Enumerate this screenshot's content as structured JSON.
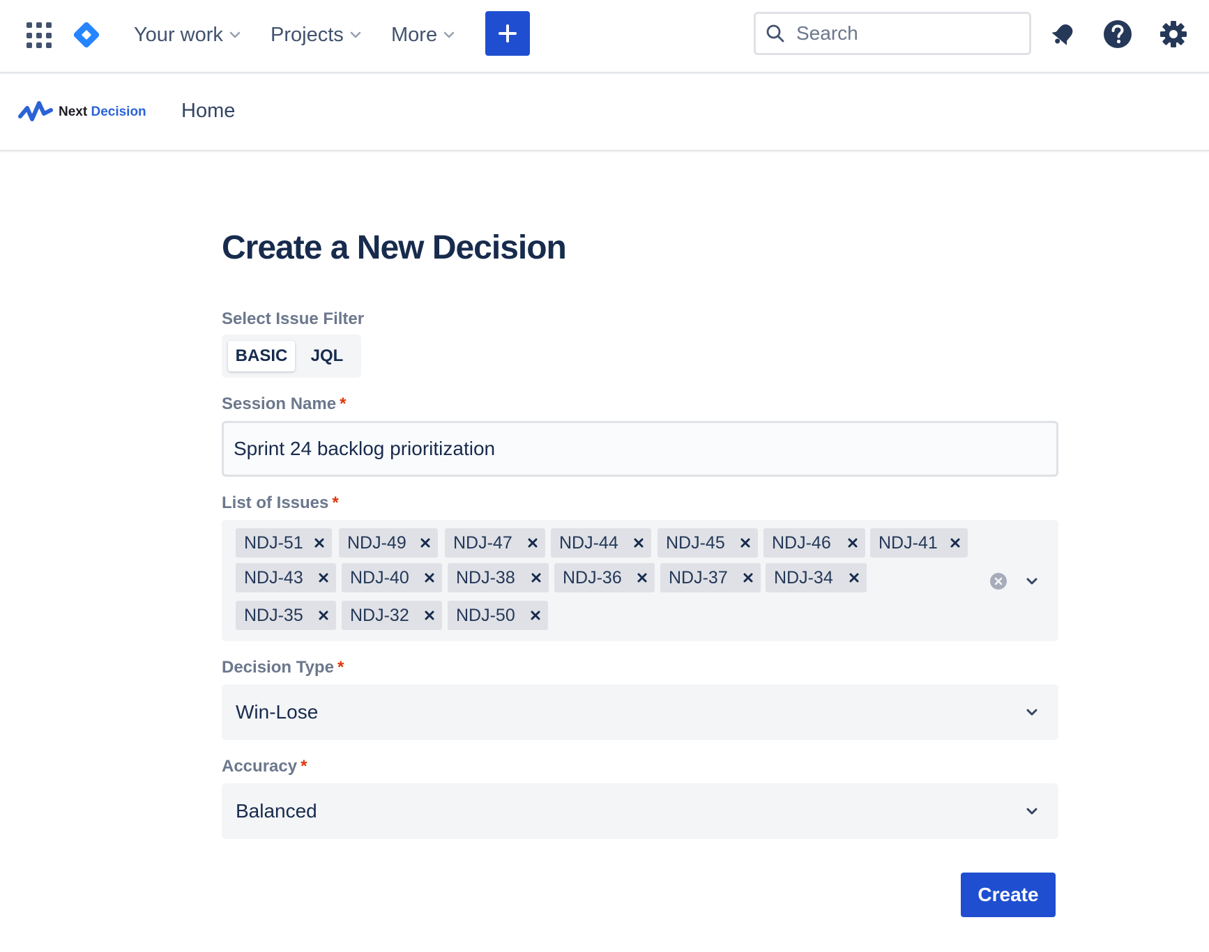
{
  "topnav": {
    "your_work": "Your work",
    "projects": "Projects",
    "more": "More",
    "search_placeholder": "Search",
    "accent_color": "#1f4fd0"
  },
  "project": {
    "brand_next": "Next",
    "brand_decision": "Decision",
    "home": "Home"
  },
  "form": {
    "title": "Create a New Decision",
    "filter_label": "Select Issue Filter",
    "filter_options": [
      "BASIC",
      "JQL"
    ],
    "filter_selected": "BASIC",
    "session_label": "Session Name",
    "session_value": "Sprint 24 backlog prioritization",
    "issues_label": "List of Issues",
    "issues": [
      "NDJ-51",
      "NDJ-49",
      "NDJ-47",
      "NDJ-44",
      "NDJ-45",
      "NDJ-46",
      "NDJ-41",
      "NDJ-43",
      "NDJ-40",
      "NDJ-38",
      "NDJ-36",
      "NDJ-37",
      "NDJ-34",
      "NDJ-35",
      "NDJ-32",
      "NDJ-50"
    ],
    "type_label": "Decision Type",
    "type_value": "Win-Lose",
    "accuracy_label": "Accuracy",
    "accuracy_value": "Balanced",
    "required_mark": "*",
    "submit": "Create"
  },
  "icons": [
    "app-switcher-icon",
    "jira-logo-icon",
    "chevron-down-icon",
    "plus-icon",
    "search-icon",
    "notification-bell-icon",
    "help-icon",
    "settings-gear-icon",
    "next-decision-logo-icon",
    "close-icon",
    "clear-all-icon"
  ]
}
